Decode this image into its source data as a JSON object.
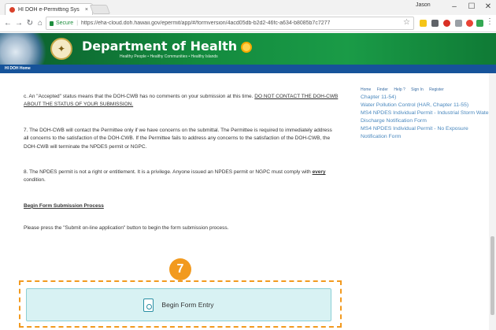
{
  "browser": {
    "tab_title": "HI DOH e-Permitting Sys",
    "tab_close": "×",
    "user_name": "Jason",
    "secure_label": "Secure",
    "url": "https://eha-cloud.doh.hawaii.gov/epermit/app/#/formversion/4acd05db-b2d2-46fc-a634-b8085b7c7277"
  },
  "header": {
    "title": "Department of Health",
    "tagline": "Healthy People • Healthy Communities • Healthy Islands"
  },
  "navbar": {
    "home": "HI DOH Home"
  },
  "content": {
    "p1_prefix": "c.   An \"Accepted\" status means that the DOH-CWB has no comments on your submission at this time.  ",
    "p1_underlined": "DO NOT CONTACT THE DOH-CWB ABOUT THE STATUS OF YOUR SUBMISSION.",
    "p2": "7.  The DOH-CWB will contact the Permittee only if we have concerns on the submittal.  The Permittee is required to immediately address all concerns to the satisfaction of the DOH-CWB.  If the Permittee fails to address any concerns to the satisfaction of the DOH-CWB, the DOH-CWB will terminate the NPDES permit or NGPC.",
    "p3_prefix": "8.  The NPDES permit is not a right or entitlement.  It is a privilege.  Anyone issued an NPDES permit or NGPC must comply with ",
    "p3_emphasis": "every",
    "p3_suffix": " condition.",
    "section_heading": "Begin Form Submission Process",
    "instruction": "Please press the \"Submit on-line application\" button to begin the form submission process."
  },
  "sidebar": {
    "links": [
      "Home",
      "Finder",
      "Help ?",
      "Sign In",
      "Register"
    ],
    "items": [
      "Chapter 11-54)",
      "Water Pollution Control (HAR, Chapter 11-55)",
      "MS4 NPDES Individual Permit - Industrial Storm Water Discharge Notification Form",
      "MS4 NPDES Individual Permit - No Exposure Notification Form"
    ]
  },
  "step": {
    "number": "7"
  },
  "entry_button": {
    "label": "Begin Form Entry"
  },
  "colors": {
    "accent_orange": "#f29a1f",
    "header_green": "#138a3e",
    "navbar_blue": "#16539a",
    "button_bg": "#d8f2f3",
    "link_blue": "#4a88be"
  }
}
